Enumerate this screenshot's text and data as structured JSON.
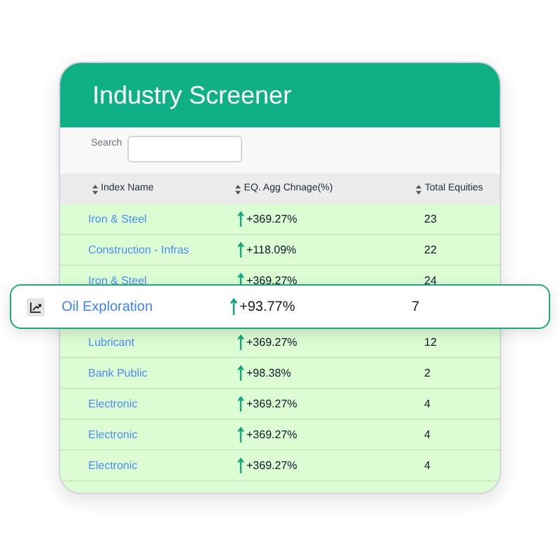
{
  "title": "Industry Screener",
  "search": {
    "label": "Search"
  },
  "columns": [
    {
      "label": "Index Name"
    },
    {
      "label": "EQ. Agg Chnage(%)"
    },
    {
      "label": "Total Equities"
    }
  ],
  "rows": [
    {
      "name": "Iron & Steel",
      "change": "+369.27%",
      "total": "23",
      "highlighted": false
    },
    {
      "name": "Construction - Infras",
      "change": "+118.09%",
      "total": "22",
      "highlighted": false
    },
    {
      "name": "Iron & Steel",
      "change": "+369.27%",
      "total": "24",
      "highlighted": false
    },
    {
      "name": "Oil Exploration",
      "change": "+93.77%",
      "total": "7",
      "highlighted": true
    },
    {
      "name": "Lubricant",
      "change": "+369.27%",
      "total": "12",
      "highlighted": false
    },
    {
      "name": "Bank Public",
      "change": "+98.38%",
      "total": "2",
      "highlighted": false
    },
    {
      "name": "Electronic",
      "change": "+369.27%",
      "total": "4",
      "highlighted": false
    },
    {
      "name": "Electronic",
      "change": "+369.27%",
      "total": "4",
      "highlighted": false
    },
    {
      "name": "Electronic",
      "change": "+369.27%",
      "total": "4",
      "highlighted": false
    }
  ]
}
